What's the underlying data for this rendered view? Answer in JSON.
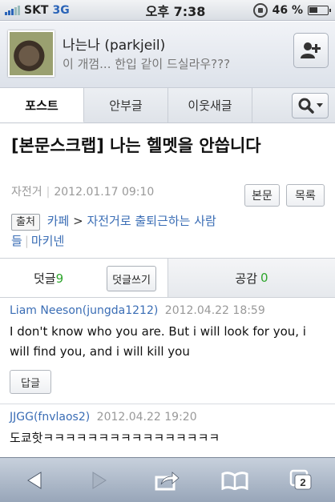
{
  "status_bar": {
    "carrier": "SKT",
    "network": "3G",
    "time": "오후 7:38",
    "battery": "46 %",
    "battery_level": 0.46,
    "icons": [
      "signal-icon",
      "rotation-lock-icon",
      "battery-icon"
    ]
  },
  "profile": {
    "name": "나는나 (parkjeil)",
    "status_message": "이 개껌... 한입 같이 드실라우???",
    "add_icon": "add-person-icon"
  },
  "tabs": [
    {
      "label": "포스트",
      "active": true
    },
    {
      "label": "안부글",
      "active": false
    },
    {
      "label": "이웃새글",
      "active": false
    }
  ],
  "search_icon": "search-icon",
  "post": {
    "title": "[본문스크랩] 나는 헬멧을 안씁니다",
    "category": "자전거",
    "date": "2012.01.17 09:10",
    "body_button": "본문",
    "list_button": "목록",
    "source_label": "출처",
    "source_type": "카페",
    "source_arrow": ">",
    "source_name": "자전거로 출퇴근하는 사람들",
    "source_author": "마키넨"
  },
  "comment_bar": {
    "comments_label": "덧글",
    "comments_count": "9",
    "write_button": "덧글쓰기",
    "likes_label": "공감",
    "likes_count": "0"
  },
  "comments": [
    {
      "author": "Liam Neeson(jungda1212)",
      "date": "2012.04.22 18:59",
      "text": "I don't know who you are. But i will look for you, i will find you, and i will kill you",
      "reply_button": "답글"
    },
    {
      "author": "JJGG(fnvlaos2)",
      "date": "2012.04.22 19:20",
      "text": "도쿄핫ㅋㅋㅋㅋㅋㅋㅋㅋㅋㅋㅋㅋㅋㅋㅋㅋ"
    }
  ],
  "toolbar": {
    "icons": [
      "back-icon",
      "forward-icon",
      "share-icon",
      "bookmarks-icon",
      "tabs-icon"
    ],
    "tab_count": "2"
  },
  "colors": {
    "link": "#3a6db5",
    "count_green": "#2ea52c",
    "network_blue": "#2a64b8"
  }
}
